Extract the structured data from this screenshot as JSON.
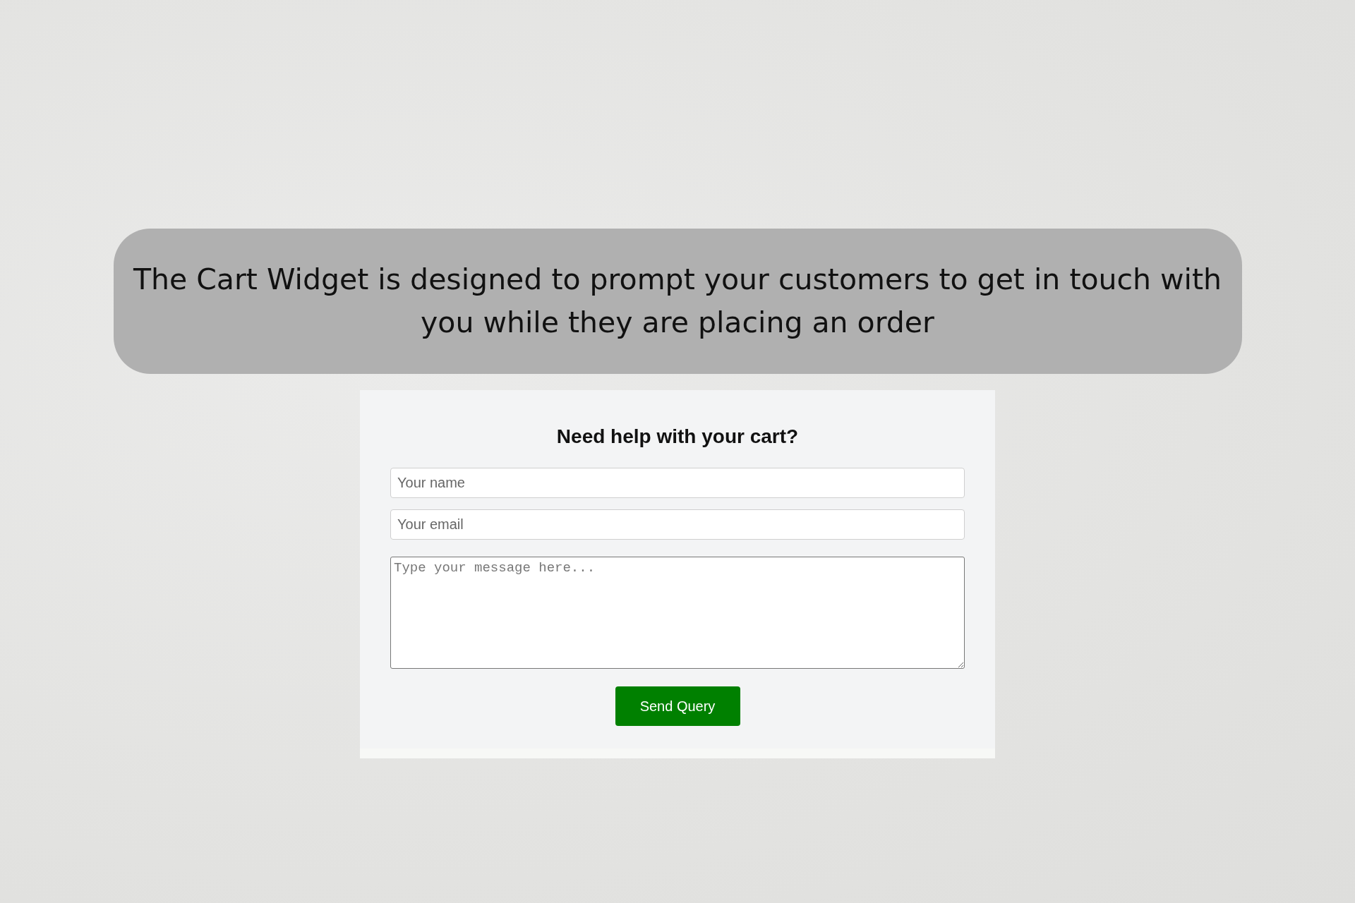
{
  "caption": "The Cart Widget is designed to prompt your customers to get in touch with you while they are placing an order",
  "form": {
    "heading": "Need help with your cart?",
    "fields": [
      {
        "kind": "input",
        "placeholder": "Your name"
      },
      {
        "kind": "input",
        "placeholder": "Your email"
      },
      {
        "kind": "textarea",
        "placeholder": "Type your message here..."
      }
    ],
    "button": "Send Query"
  }
}
